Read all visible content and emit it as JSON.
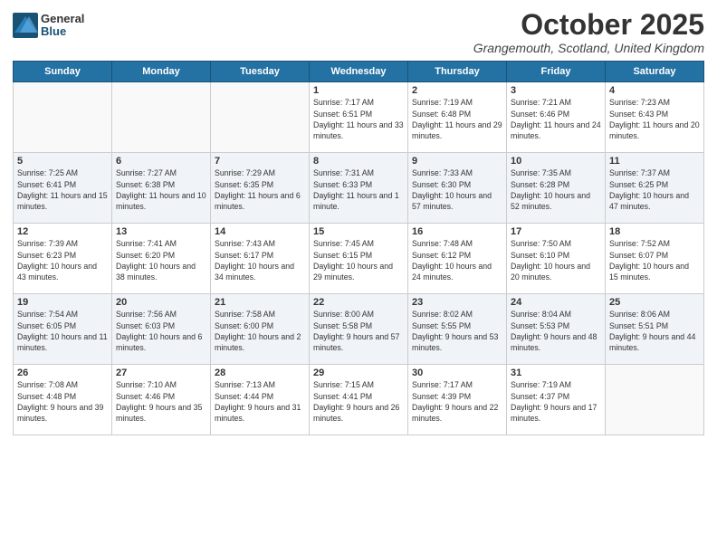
{
  "header": {
    "logo_general": "General",
    "logo_blue": "Blue",
    "title": "October 2025",
    "location": "Grangemouth, Scotland, United Kingdom"
  },
  "weekdays": [
    "Sunday",
    "Monday",
    "Tuesday",
    "Wednesday",
    "Thursday",
    "Friday",
    "Saturday"
  ],
  "weeks": [
    [
      {
        "day": "",
        "info": ""
      },
      {
        "day": "",
        "info": ""
      },
      {
        "day": "",
        "info": ""
      },
      {
        "day": "1",
        "info": "Sunrise: 7:17 AM\nSunset: 6:51 PM\nDaylight: 11 hours and 33 minutes."
      },
      {
        "day": "2",
        "info": "Sunrise: 7:19 AM\nSunset: 6:48 PM\nDaylight: 11 hours and 29 minutes."
      },
      {
        "day": "3",
        "info": "Sunrise: 7:21 AM\nSunset: 6:46 PM\nDaylight: 11 hours and 24 minutes."
      },
      {
        "day": "4",
        "info": "Sunrise: 7:23 AM\nSunset: 6:43 PM\nDaylight: 11 hours and 20 minutes."
      }
    ],
    [
      {
        "day": "5",
        "info": "Sunrise: 7:25 AM\nSunset: 6:41 PM\nDaylight: 11 hours and 15 minutes."
      },
      {
        "day": "6",
        "info": "Sunrise: 7:27 AM\nSunset: 6:38 PM\nDaylight: 11 hours and 10 minutes."
      },
      {
        "day": "7",
        "info": "Sunrise: 7:29 AM\nSunset: 6:35 PM\nDaylight: 11 hours and 6 minutes."
      },
      {
        "day": "8",
        "info": "Sunrise: 7:31 AM\nSunset: 6:33 PM\nDaylight: 11 hours and 1 minute."
      },
      {
        "day": "9",
        "info": "Sunrise: 7:33 AM\nSunset: 6:30 PM\nDaylight: 10 hours and 57 minutes."
      },
      {
        "day": "10",
        "info": "Sunrise: 7:35 AM\nSunset: 6:28 PM\nDaylight: 10 hours and 52 minutes."
      },
      {
        "day": "11",
        "info": "Sunrise: 7:37 AM\nSunset: 6:25 PM\nDaylight: 10 hours and 47 minutes."
      }
    ],
    [
      {
        "day": "12",
        "info": "Sunrise: 7:39 AM\nSunset: 6:23 PM\nDaylight: 10 hours and 43 minutes."
      },
      {
        "day": "13",
        "info": "Sunrise: 7:41 AM\nSunset: 6:20 PM\nDaylight: 10 hours and 38 minutes."
      },
      {
        "day": "14",
        "info": "Sunrise: 7:43 AM\nSunset: 6:17 PM\nDaylight: 10 hours and 34 minutes."
      },
      {
        "day": "15",
        "info": "Sunrise: 7:45 AM\nSunset: 6:15 PM\nDaylight: 10 hours and 29 minutes."
      },
      {
        "day": "16",
        "info": "Sunrise: 7:48 AM\nSunset: 6:12 PM\nDaylight: 10 hours and 24 minutes."
      },
      {
        "day": "17",
        "info": "Sunrise: 7:50 AM\nSunset: 6:10 PM\nDaylight: 10 hours and 20 minutes."
      },
      {
        "day": "18",
        "info": "Sunrise: 7:52 AM\nSunset: 6:07 PM\nDaylight: 10 hours and 15 minutes."
      }
    ],
    [
      {
        "day": "19",
        "info": "Sunrise: 7:54 AM\nSunset: 6:05 PM\nDaylight: 10 hours and 11 minutes."
      },
      {
        "day": "20",
        "info": "Sunrise: 7:56 AM\nSunset: 6:03 PM\nDaylight: 10 hours and 6 minutes."
      },
      {
        "day": "21",
        "info": "Sunrise: 7:58 AM\nSunset: 6:00 PM\nDaylight: 10 hours and 2 minutes."
      },
      {
        "day": "22",
        "info": "Sunrise: 8:00 AM\nSunset: 5:58 PM\nDaylight: 9 hours and 57 minutes."
      },
      {
        "day": "23",
        "info": "Sunrise: 8:02 AM\nSunset: 5:55 PM\nDaylight: 9 hours and 53 minutes."
      },
      {
        "day": "24",
        "info": "Sunrise: 8:04 AM\nSunset: 5:53 PM\nDaylight: 9 hours and 48 minutes."
      },
      {
        "day": "25",
        "info": "Sunrise: 8:06 AM\nSunset: 5:51 PM\nDaylight: 9 hours and 44 minutes."
      }
    ],
    [
      {
        "day": "26",
        "info": "Sunrise: 7:08 AM\nSunset: 4:48 PM\nDaylight: 9 hours and 39 minutes."
      },
      {
        "day": "27",
        "info": "Sunrise: 7:10 AM\nSunset: 4:46 PM\nDaylight: 9 hours and 35 minutes."
      },
      {
        "day": "28",
        "info": "Sunrise: 7:13 AM\nSunset: 4:44 PM\nDaylight: 9 hours and 31 minutes."
      },
      {
        "day": "29",
        "info": "Sunrise: 7:15 AM\nSunset: 4:41 PM\nDaylight: 9 hours and 26 minutes."
      },
      {
        "day": "30",
        "info": "Sunrise: 7:17 AM\nSunset: 4:39 PM\nDaylight: 9 hours and 22 minutes."
      },
      {
        "day": "31",
        "info": "Sunrise: 7:19 AM\nSunset: 4:37 PM\nDaylight: 9 hours and 17 minutes."
      },
      {
        "day": "",
        "info": ""
      }
    ]
  ]
}
